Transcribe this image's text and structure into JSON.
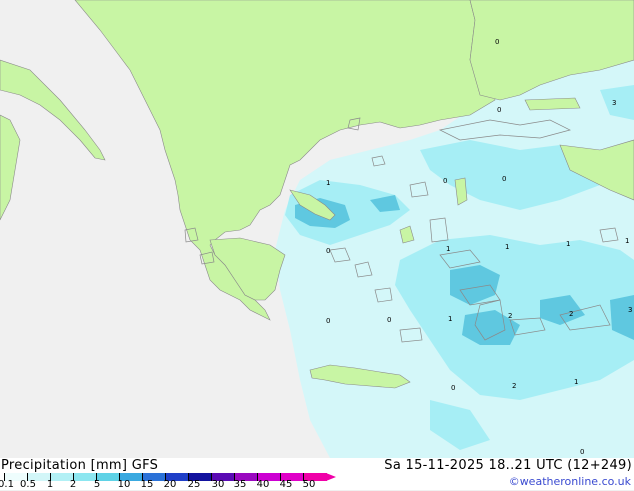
{
  "title": "Precipitation [mm] GFS",
  "datetime": "Sa 15-11-2025 18..21 UTC (12+249)",
  "credit": "©weatheronline.co.uk",
  "legend": {
    "labels": [
      "0.1",
      "0.5",
      "1",
      "2",
      "5",
      "10",
      "15",
      "20",
      "25",
      "30",
      "35",
      "40",
      "45",
      "50"
    ],
    "colors": [
      "#eefdfd",
      "#d2f6f8",
      "#b2f0f5",
      "#8ce6f0",
      "#5fd2e6",
      "#3aa9e0",
      "#2b72d8",
      "#1f3fc8",
      "#12129e",
      "#5a0ab4",
      "#9a08c0",
      "#cc00d2",
      "#e000c8",
      "#f000a8"
    ]
  },
  "map": {
    "colors": {
      "sea": "#f0f0f0",
      "land": "#c8f5a4",
      "precip_light": "#d4f7f9",
      "precip_medium": "#a6eef5",
      "precip_heavy": "#5fc8e0"
    },
    "values": [
      {
        "id": "v1",
        "text": "0"
      },
      {
        "id": "v2",
        "text": "3"
      },
      {
        "id": "v3",
        "text": "1"
      },
      {
        "id": "v4",
        "text": "0"
      },
      {
        "id": "v5",
        "text": "0"
      },
      {
        "id": "v6",
        "text": "0"
      },
      {
        "id": "v7",
        "text": "1"
      },
      {
        "id": "v8",
        "text": "1"
      },
      {
        "id": "v9",
        "text": "1"
      },
      {
        "id": "v10",
        "text": "1"
      },
      {
        "id": "v11",
        "text": "0"
      },
      {
        "id": "v12",
        "text": "0"
      },
      {
        "id": "v13",
        "text": "2"
      },
      {
        "id": "v14",
        "text": "1"
      },
      {
        "id": "v15",
        "text": "2"
      },
      {
        "id": "v16",
        "text": "3"
      },
      {
        "id": "v17",
        "text": "0"
      },
      {
        "id": "v18",
        "text": "2"
      },
      {
        "id": "v19",
        "text": "1"
      },
      {
        "id": "v20",
        "text": "0"
      },
      {
        "id": "v21",
        "text": "0"
      }
    ]
  }
}
